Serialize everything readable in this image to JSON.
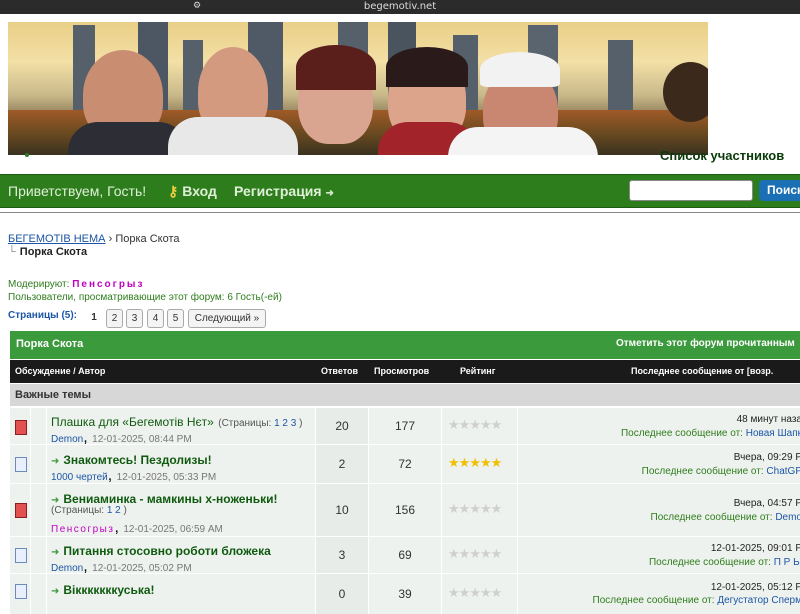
{
  "browser": {
    "url": "begemotiv.net"
  },
  "header": {
    "members_title": "Список участников"
  },
  "nav": {
    "greeting": "Приветствуем, Гость!",
    "login": "Вход",
    "register": "Регистрация",
    "search_button": "Поиск"
  },
  "breadcrumb": {
    "root": "БЕГЕМОТІВ НЕМА",
    "sep": "›",
    "current": "Порка Скота"
  },
  "forum": {
    "title": "Порка Скота",
    "moderators_label": "Модерируют:",
    "moderator": "Пенсогрыз",
    "viewers": "Пользователи, просматривающие этот форум: 6 Гость(-ей)"
  },
  "pagination": {
    "label": "Страницы (5):",
    "pages": [
      "1",
      "2",
      "3",
      "4",
      "5"
    ],
    "current": "1",
    "next": "Следующий »"
  },
  "table": {
    "title": "Порка Скота",
    "mark_read": "Отметить этот форум прочитанным",
    "columns": {
      "topic": "Обсуждение / Автор",
      "replies": "Ответов",
      "views": "Просмотров",
      "rating": "Рейтинг",
      "last": "Последнее сообщение от [возр."
    },
    "sticky_label": "Важные темы",
    "rows": [
      {
        "title": "Плашка для «Бегемотів Нєт»",
        "pages_label": "(Страницы:",
        "pages": "1 2 3",
        "pages_close": ")",
        "author": "Demon",
        "date": "12-01-2025, 08:44 PM",
        "replies": "20",
        "views": "177",
        "rating": 0,
        "last_time": "48 минут наза",
        "last_by_label": "Последнее сообщение от:",
        "last_by": "Новая Шапк"
      },
      {
        "title": "Знакомтесь! Пездолизы!",
        "author": "1000 чертей",
        "date": "12-01-2025, 05:33 PM",
        "replies": "2",
        "views": "72",
        "rating": 5,
        "last_time": "Вчера, 09:29 Р",
        "last_by_label": "Последнее сообщение от:",
        "last_by": "ChatGP"
      },
      {
        "title": "Вениаминка - мамкины х-ноженьки!",
        "pages_label": "(Страницы:",
        "pages": "1 2",
        "pages_close": ")",
        "author": "Пенсогрыз",
        "date": "12-01-2025, 06:59 AM",
        "replies": "10",
        "views": "156",
        "rating": 0,
        "last_time": "Вчера, 04:57 Р",
        "last_by_label": "Последнее сообщение от:",
        "last_by": "Demo"
      },
      {
        "title": "Питання стосовно роботи бложека",
        "author": "Demon",
        "date": "12-01-2025, 05:02 PM",
        "replies": "3",
        "views": "69",
        "rating": 0,
        "last_time": "12-01-2025, 09:01 Р",
        "last_by_label": "Последнее сообщение от:",
        "last_by": "П Р Ы"
      },
      {
        "title": "Вікккккккуська!",
        "author": "",
        "date": "",
        "replies": "0",
        "views": "39",
        "rating": 0,
        "last_time": "12-01-2025, 05:12 Р",
        "last_by_label": "Последнее сообщение от:",
        "last_by": "Дегустатор Сперм"
      }
    ]
  }
}
